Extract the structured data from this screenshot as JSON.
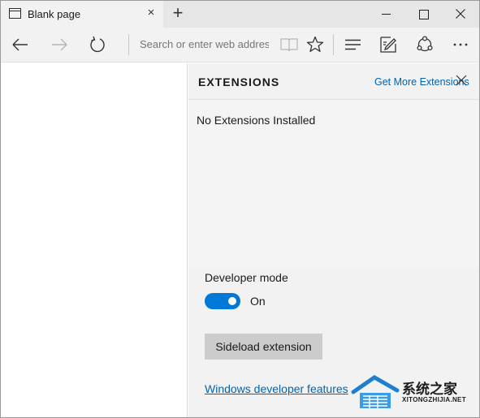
{
  "tab": {
    "title": "Blank page",
    "close_glyph": "×",
    "new_tab_glyph": "+"
  },
  "window_controls": {
    "minimize": "minimize-icon",
    "maximize": "maximize-icon",
    "close": "close-icon"
  },
  "toolbar": {
    "back_icon": "back-arrow-icon",
    "forward_icon": "forward-arrow-icon",
    "refresh_icon": "refresh-icon",
    "address_placeholder": "Search or enter web address",
    "reading_view_icon": "book-icon",
    "favorite_icon": "star-icon",
    "hub_icon": "hub-lines-icon",
    "note_icon": "web-note-icon",
    "share_icon": "share-icon",
    "more_icon": "more-dots-icon"
  },
  "extensions_pane": {
    "title": "EXTENSIONS",
    "get_more_link": "Get More Extensions",
    "empty_message": "No Extensions Installed",
    "developer_mode_label": "Developer mode",
    "toggle_state": "On",
    "sideload_button": "Sideload extension",
    "developer_features_link": "Windows developer features"
  },
  "watermark": {
    "text_cn": "系统之家",
    "text_en": "XITONGZHIJIA.NET"
  },
  "colors": {
    "accent": "#0078d7",
    "link": "#0063b1",
    "pane_bg": "#f2f2f2",
    "button_bg": "#cccccc"
  }
}
